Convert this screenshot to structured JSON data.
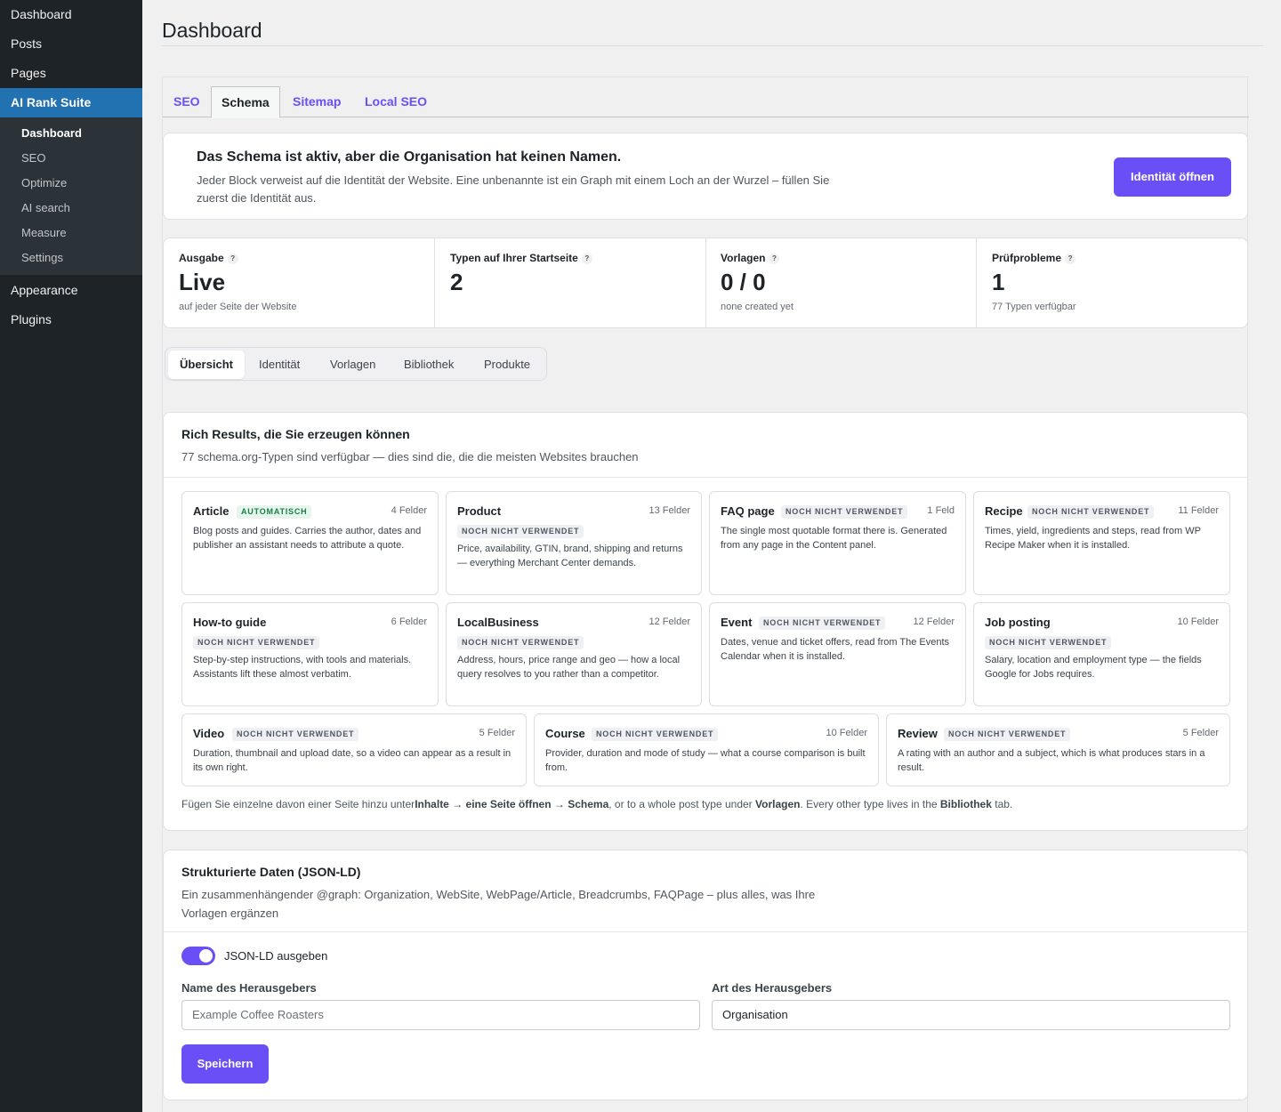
{
  "sidebar": {
    "top_items": [
      "Dashboard",
      "Posts",
      "Pages"
    ],
    "active": "AI Rank Suite",
    "sub_items": [
      {
        "label": "Dashboard"
      },
      {
        "label": "SEO"
      },
      {
        "label": "Optimize"
      },
      {
        "label": "AI search"
      },
      {
        "label": "Measure"
      },
      {
        "label": "Settings"
      }
    ],
    "bottom_items": [
      "Appearance",
      "Plugins"
    ]
  },
  "page": {
    "title": "Dashboard"
  },
  "tabs": [
    "SEO",
    "Schema",
    "Sitemap",
    "Local SEO"
  ],
  "notice": {
    "title": "Das Schema ist aktiv, aber die Organisation hat keinen Namen.",
    "text": "Jeder Block verweist auf die Identität der Website. Eine unbenannte ist ein Graph mit einem Loch an der Wurzel – füllen Sie zuerst die Identität aus.",
    "button": "Identität öffnen"
  },
  "stats": [
    {
      "label": "Ausgabe",
      "help": "?",
      "value": "Live",
      "sub": "auf jeder Seite der Website"
    },
    {
      "label": "Typen auf Ihrer Startseite",
      "help": "?",
      "value": "2",
      "sub": ""
    },
    {
      "label": "Vorlagen",
      "help": "?",
      "value": "0 / 0",
      "sub": "none created yet"
    },
    {
      "label": "Prüfprobleme",
      "help": "?",
      "value": "1",
      "sub": "77 Typen verfügbar"
    }
  ],
  "subtabs": [
    "Übersicht",
    "Identität",
    "Vorlagen",
    "Bibliothek",
    "Produkte"
  ],
  "rich": {
    "title": "Rich Results, die Sie erzeugen können",
    "desc": "77 schema.org-Typen sind verfügbar — dies sind die, die die meisten Websites brauchen",
    "types": [
      {
        "name": "Article",
        "badge": "AUTOMATISCH",
        "fields": "4 Felder",
        "desc": "Blog posts and guides. Carries the author, dates and publisher an assistant needs to attribute a quote."
      },
      {
        "name": "Product",
        "badge": "NOCH NICHT VERWENDET",
        "fields": "13 Felder",
        "desc": "Price, availability, GTIN, brand, shipping and returns — everything Merchant Center demands."
      },
      {
        "name": "FAQ page",
        "badge": "NOCH NICHT VERWENDET",
        "fields": "1 Feld",
        "desc": "The single most quotable format there is. Generated from any page in the Content panel."
      },
      {
        "name": "Recipe",
        "badge": "NOCH NICHT VERWENDET",
        "fields": "11 Felder",
        "desc": "Times, yield, ingredients and steps, read from WP Recipe Maker when it is installed."
      },
      {
        "name": "How-to guide",
        "badge": "NOCH NICHT VERWENDET",
        "fields": "6 Felder",
        "desc": "Step-by-step instructions, with tools and materials. Assistants lift these almost verbatim."
      },
      {
        "name": "LocalBusiness",
        "badge": "NOCH NICHT VERWENDET",
        "fields": "12 Felder",
        "desc": "Address, hours, price range and geo — how a local query resolves to you rather than a competitor."
      },
      {
        "name": "Event",
        "badge": "NOCH NICHT VERWENDET",
        "fields": "12 Felder",
        "desc": "Dates, venue and ticket offers, read from The Events Calendar when it is installed."
      },
      {
        "name": "Job posting",
        "badge": "NOCH NICHT VERWENDET",
        "fields": "10 Felder",
        "desc": "Salary, location and employment type — the fields Google for Jobs requires."
      },
      {
        "name": "Video",
        "badge": "NOCH NICHT VERWENDET",
        "fields": "5 Felder",
        "desc": "Duration, thumbnail and upload date, so a video can appear as a result in its own right."
      },
      {
        "name": "Course",
        "badge": "NOCH NICHT VERWENDET",
        "fields": "10 Felder",
        "desc": "Provider, duration and mode of study — what a course comparison is built from."
      },
      {
        "name": "Review",
        "badge": "NOCH NICHT VERWENDET",
        "fields": "5 Felder",
        "desc": "A rating with an author and a subject, which is what produces stars in a result."
      }
    ],
    "footer": {
      "t1": "Fügen Sie einzelne davon einer Seite hinzu unter",
      "b1": "Inhalte → eine Seite öffnen → Schema",
      "t2": ", or to a whole post type under ",
      "b2": "Vorlagen",
      "t3": ". Every other type lives in the ",
      "b3": "Bibliothek",
      "t4": " tab."
    }
  },
  "jsonld": {
    "title": "Strukturierte Daten (JSON-LD)",
    "desc": "Ein zusammenhängender @graph: Organization, WebSite, WebPage/Article, Breadcrumbs, FAQPage – plus alles, was Ihre Vorlagen ergänzen",
    "toggle_label": "JSON-LD ausgeben",
    "toggle_on": true,
    "publisher_name_label": "Name des Herausgebers",
    "publisher_name_placeholder": "Example Coffee Roasters",
    "publisher_type_label": "Art des Herausgebers",
    "publisher_type_value": "Organisation",
    "save": "Speichern"
  },
  "colors": {
    "accent": "#6a4ff7",
    "sidebar": "#1d2327",
    "active_menu": "#2271b1",
    "warning": "#f0a030",
    "auto_badge": "#1a7f44"
  }
}
